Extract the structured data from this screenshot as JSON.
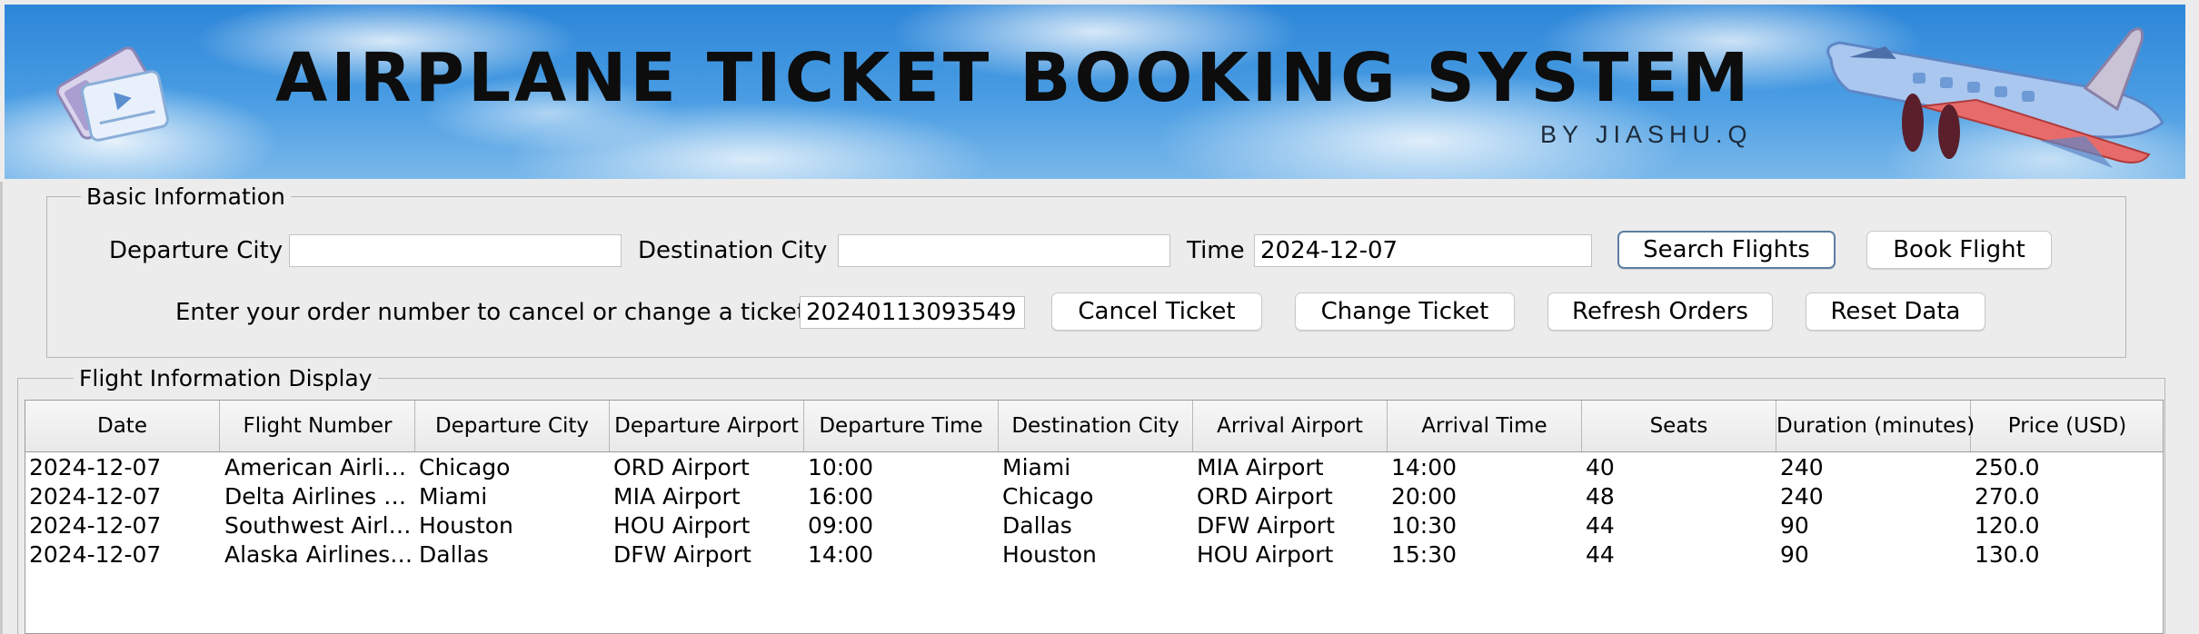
{
  "banner": {
    "title": "AIRPLANE TICKET BOOKING SYSTEM",
    "subtitle": "BY JIASHU.Q"
  },
  "basic_info": {
    "group_title": "Basic Information",
    "departure_label": "Departure City",
    "departure_value": "",
    "destination_label": "Destination City",
    "destination_value": "",
    "time_label": "Time",
    "time_value": "2024-12-07",
    "search_button": "Search Flights",
    "book_button": "Book Flight",
    "order_label": "Enter your order number to cancel or change a ticket:",
    "order_value": "20240113093549",
    "cancel_button": "Cancel Ticket",
    "change_button": "Change Ticket",
    "refresh_button": "Refresh Orders",
    "reset_button": "Reset Data"
  },
  "flight_display": {
    "group_title": "Flight Information Display",
    "columns": [
      "Date",
      "Flight Number",
      "Departure City",
      "Departure Airport",
      "Departure Time",
      "Destination City",
      "Arrival Airport",
      "Arrival Time",
      "Seats",
      "Duration (minutes)",
      "Price (USD)"
    ],
    "rows": [
      [
        "2024-12-07",
        "American Airlin...",
        "Chicago",
        "ORD Airport",
        "10:00",
        "Miami",
        "MIA Airport",
        "14:00",
        "40",
        "240",
        "250.0"
      ],
      [
        "2024-12-07",
        "Delta Airlines D...",
        "Miami",
        "MIA Airport",
        "16:00",
        "Chicago",
        "ORD Airport",
        "20:00",
        "48",
        "240",
        "270.0"
      ],
      [
        "2024-12-07",
        "Southwest Airlin...",
        "Houston",
        "HOU Airport",
        "09:00",
        "Dallas",
        "DFW Airport",
        "10:30",
        "44",
        "90",
        "120.0"
      ],
      [
        "2024-12-07",
        "Alaska Airlines ...",
        "Dallas",
        "DFW Airport",
        "14:00",
        "Houston",
        "HOU Airport",
        "15:30",
        "44",
        "90",
        "130.0"
      ]
    ]
  },
  "icons": [
    "ticket-icon",
    "airplane-icon"
  ],
  "colors": {
    "sky": "#2d86d8",
    "window_bg": "#ececec",
    "focus_border": "#5d7ea3"
  }
}
